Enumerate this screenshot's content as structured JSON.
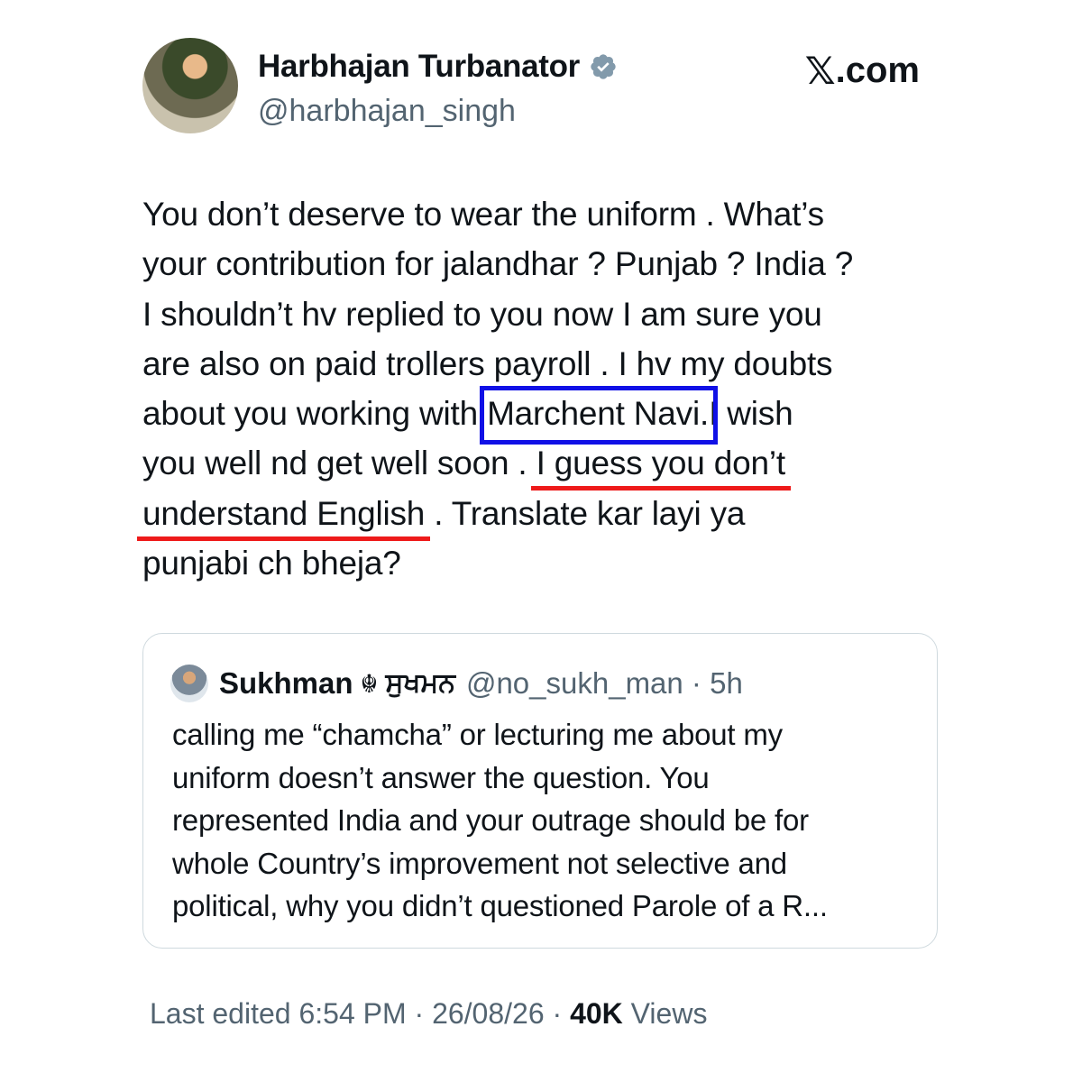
{
  "author": {
    "name": "Harbhajan Turbanator",
    "handle": "@harbhajan_singh"
  },
  "brand": {
    "mark": "𝕏",
    "suffix": ".com"
  },
  "tweet": {
    "lines": [
      "You don’t deserve to wear the uniform . What’s",
      "your contribution for jalandhar ? Punjab ? India ?",
      "I shouldn’t hv replied to you now I am sure you",
      "are also on paid trollers  payroll . I hv my doubts"
    ],
    "line5_before": "about you working with ",
    "line5_boxed": "Marchent Navi.",
    "line5_after": "I wish",
    "line6_before": "you well nd get well soon . ",
    "line6_underlined": "I guess you don’t",
    "line7_underlined": "understand English",
    "line7_after": " . Translate kar layi ya",
    "line8": "punjabi ch bheja?"
  },
  "quote": {
    "name": "Sukhman",
    "glyph": "☬",
    "name_punjabi": "ਸੁਖਮਨ",
    "handle_time": "@no_sukh_man · 5h",
    "lines": [
      "calling me “chamcha” or lecturing me about my",
      "uniform doesn’t answer the question. You",
      "represented India and your outrage should be for",
      "whole Country’s improvement not selective and",
      "political, why you didn’t questioned Parole of a R..."
    ]
  },
  "meta": {
    "edited": "Last edited 6:54 PM · 26/08/26  · ",
    "views_count": "40K",
    "views_label": " Views"
  },
  "colors": {
    "highlight_box": "#1010e6",
    "underline": "#ee1a1a",
    "verified": "#829aab"
  }
}
